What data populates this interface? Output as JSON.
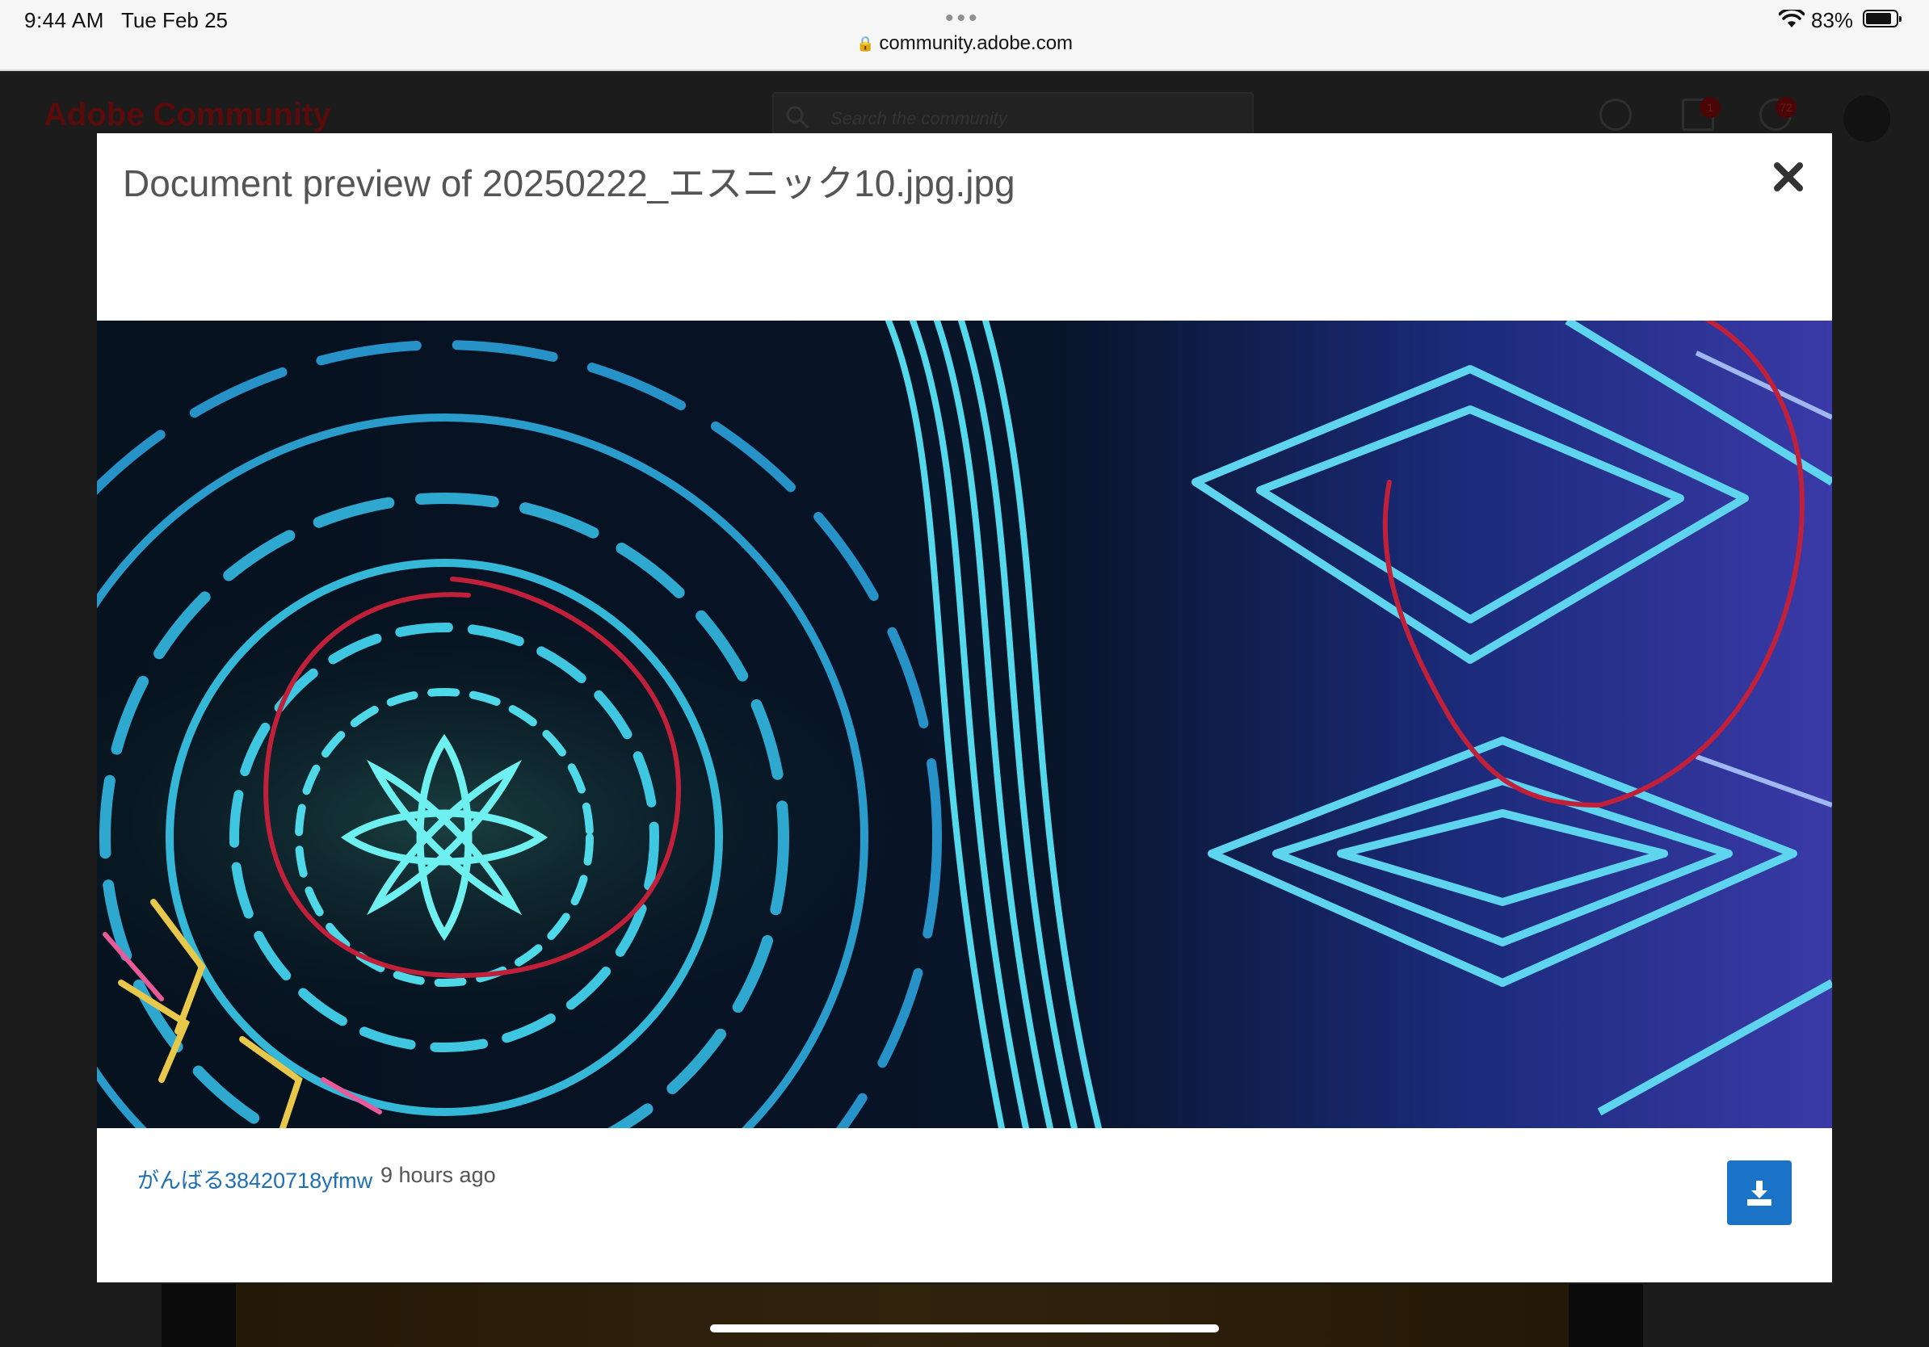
{
  "status_bar": {
    "time": "9:44 AM",
    "date": "Tue Feb 25",
    "url": "community.adobe.com",
    "battery": "83%"
  },
  "background_page": {
    "brand": "Adobe Community",
    "search_placeholder": "Search the community",
    "messages_badge": "1",
    "notifications_badge": "72"
  },
  "modal": {
    "title": "Document preview of 20250222_エスニック10.jpg.jpg",
    "author": "がんばる38420718yfmw",
    "time_ago": "9 hours ago",
    "close_icon": "close-icon",
    "download_icon": "download-icon"
  },
  "colors": {
    "link": "#1f6fb5",
    "download_button": "#1a73c6",
    "annotation_red": "#c0203a"
  }
}
